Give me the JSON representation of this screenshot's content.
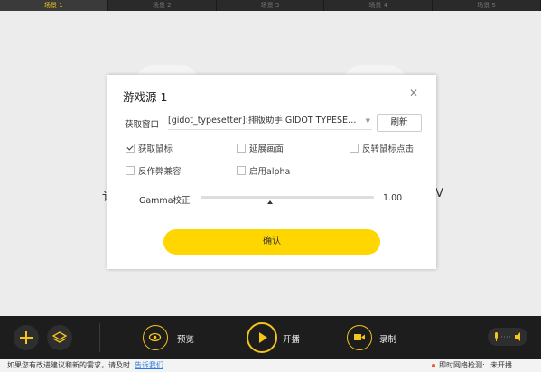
{
  "scene_tabs": [
    "场景 1",
    "场景 2",
    "场景 3",
    "场景 4",
    "场景 5"
  ],
  "canvas": {
    "left_glyph": "讠",
    "right_glyph": "V"
  },
  "dialog": {
    "title": "游戏源 1",
    "close_icon": "close-icon",
    "capture_window_label": "获取窗口",
    "capture_window_value": "[gidot_typesetter]:排版助手 GIDOT TYPESETTER",
    "refresh_label": "刷新",
    "options": [
      {
        "label": "获取鼠标",
        "checked": true
      },
      {
        "label": "延展画面",
        "checked": false
      },
      {
        "label": "反转鼠标点击",
        "checked": false
      },
      {
        "label": "反作弊兼容",
        "checked": false
      },
      {
        "label": "启用alpha",
        "checked": false
      }
    ],
    "gamma_label": "Gamma校正",
    "gamma_value": "1.00",
    "confirm_label": "确认"
  },
  "toolbar": {
    "preview_label": "预览",
    "live_label": "开播",
    "record_label": "录制"
  },
  "status": {
    "feedback_text": "如果您有改进建议和新的需求，请及时",
    "feedback_link": "告诉我们",
    "network_label": "即时网络检测:",
    "network_status": "未开播"
  },
  "colors": {
    "accent": "#ffd600",
    "toolbar_bg": "#1d1d1d",
    "status_dot": "#e8572a"
  }
}
